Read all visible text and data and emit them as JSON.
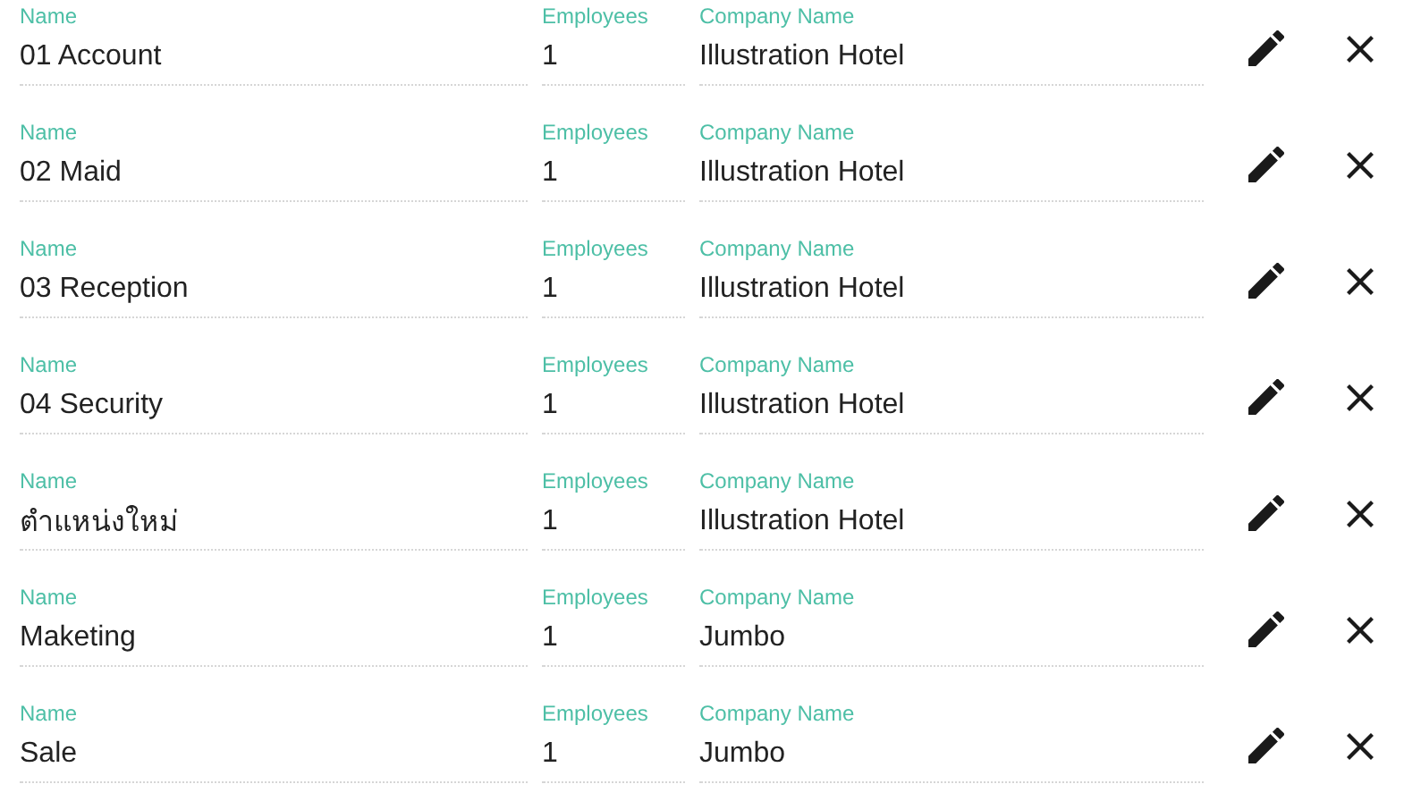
{
  "rows": [
    {
      "name_label": "Name",
      "name": "01 Account",
      "employees_label": "Employees",
      "employees": "1",
      "company_label": "Company Name",
      "company": "Illustration Hotel"
    },
    {
      "name_label": "Name",
      "name": "02 Maid",
      "employees_label": "Employees",
      "employees": "1",
      "company_label": "Company Name",
      "company": "Illustration Hotel"
    },
    {
      "name_label": "Name",
      "name": "03 Reception",
      "employees_label": "Employees",
      "employees": "1",
      "company_label": "Company Name",
      "company": "Illustration Hotel"
    },
    {
      "name_label": "Name",
      "name": "04 Security",
      "employees_label": "Employees",
      "employees": "1",
      "company_label": "Company Name",
      "company": "Illustration Hotel"
    },
    {
      "name_label": "Name",
      "name": "ตำแหน่งใหม่",
      "employees_label": "Employees",
      "employees": "1",
      "company_label": "Company Name",
      "company": "Illustration Hotel"
    },
    {
      "name_label": "Name",
      "name": "Maketing",
      "employees_label": "Employees",
      "employees": "1",
      "company_label": "Company Name",
      "company": "Jumbo"
    },
    {
      "name_label": "Name",
      "name": "Sale",
      "employees_label": "Employees",
      "employees": "1",
      "company_label": "Company Name",
      "company": "Jumbo"
    }
  ]
}
